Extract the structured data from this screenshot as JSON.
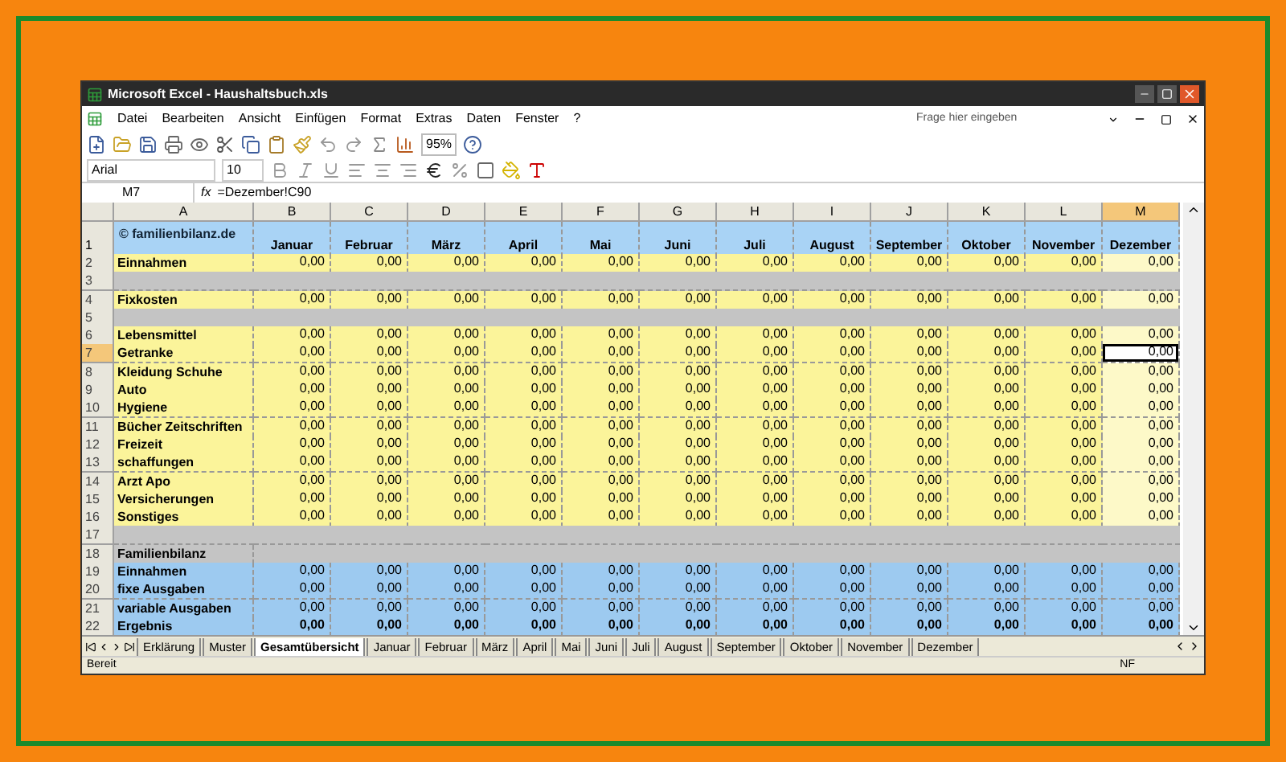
{
  "window": {
    "title": "Microsoft Excel - Haushaltsbuch.xls"
  },
  "menu": [
    "Datei",
    "Bearbeiten",
    "Ansicht",
    "Einfügen",
    "Format",
    "Extras",
    "Daten",
    "Fenster",
    "?"
  ],
  "help_field": {
    "placeholder": "Frage hier eingeben"
  },
  "toolbar": {
    "zoom": "95%",
    "font": "Arial",
    "font_size": "10"
  },
  "formula_bar": {
    "name_box": "M7",
    "fx": "fx",
    "formula": "=Dezember!C90"
  },
  "columns": [
    {
      "label": "A",
      "selected": false
    },
    {
      "label": "B",
      "selected": false
    },
    {
      "label": "C",
      "selected": false
    },
    {
      "label": "D",
      "selected": false
    },
    {
      "label": "E",
      "selected": false
    },
    {
      "label": "F",
      "selected": false
    },
    {
      "label": "G",
      "selected": false
    },
    {
      "label": "H",
      "selected": false
    },
    {
      "label": "I",
      "selected": false
    },
    {
      "label": "J",
      "selected": false
    },
    {
      "label": "K",
      "selected": false
    },
    {
      "label": "L",
      "selected": false
    },
    {
      "label": "M",
      "selected": true
    }
  ],
  "header_row": {
    "number": "1",
    "label": "© familienbilanz.de",
    "months": [
      "Januar",
      "Februar",
      "März",
      "April",
      "Mai",
      "Juni",
      "Juli",
      "August",
      "September",
      "Oktober",
      "November",
      "Dezember"
    ]
  },
  "rows": [
    {
      "number": "2",
      "kind": "data",
      "selected": false,
      "label": "Einnahmen",
      "values": [
        "0,00",
        "0,00",
        "0,00",
        "0,00",
        "0,00",
        "0,00",
        "0,00",
        "0,00",
        "0,00",
        "0,00",
        "0,00",
        "0,00"
      ]
    },
    {
      "number": "3",
      "kind": "gap",
      "selected": false
    },
    {
      "number": "4",
      "kind": "data",
      "selected": false,
      "label": "Fixkosten",
      "values": [
        "0,00",
        "0,00",
        "0,00",
        "0,00",
        "0,00",
        "0,00",
        "0,00",
        "0,00",
        "0,00",
        "0,00",
        "0,00",
        "0,00"
      ]
    },
    {
      "number": "5",
      "kind": "gap",
      "selected": false
    },
    {
      "number": "6",
      "kind": "data",
      "selected": false,
      "label": "Lebensmittel",
      "values": [
        "0,00",
        "0,00",
        "0,00",
        "0,00",
        "0,00",
        "0,00",
        "0,00",
        "0,00",
        "0,00",
        "0,00",
        "0,00",
        "0,00"
      ]
    },
    {
      "number": "7",
      "kind": "data",
      "selected": true,
      "label": "Getranke",
      "values": [
        "0,00",
        "0,00",
        "0,00",
        "0,00",
        "0,00",
        "0,00",
        "0,00",
        "0,00",
        "0,00",
        "0,00",
        "0,00",
        "0,00"
      ]
    },
    {
      "number": "8",
      "kind": "data",
      "selected": false,
      "label": "Kleidung  Schuhe",
      "values": [
        "0,00",
        "0,00",
        "0,00",
        "0,00",
        "0,00",
        "0,00",
        "0,00",
        "0,00",
        "0,00",
        "0,00",
        "0,00",
        "0,00"
      ]
    },
    {
      "number": "9",
      "kind": "data",
      "selected": false,
      "label": "Auto",
      "values": [
        "0,00",
        "0,00",
        "0,00",
        "0,00",
        "0,00",
        "0,00",
        "0,00",
        "0,00",
        "0,00",
        "0,00",
        "0,00",
        "0,00"
      ]
    },
    {
      "number": "10",
      "kind": "data",
      "selected": false,
      "label": "Hygiene",
      "values": [
        "0,00",
        "0,00",
        "0,00",
        "0,00",
        "0,00",
        "0,00",
        "0,00",
        "0,00",
        "0,00",
        "0,00",
        "0,00",
        "0,00"
      ]
    },
    {
      "number": "11",
      "kind": "data",
      "selected": false,
      "label": "Bücher Zeitschriften",
      "values": [
        "0,00",
        "0,00",
        "0,00",
        "0,00",
        "0,00",
        "0,00",
        "0,00",
        "0,00",
        "0,00",
        "0,00",
        "0,00",
        "0,00"
      ]
    },
    {
      "number": "12",
      "kind": "data",
      "selected": false,
      "label": "Freizeit",
      "values": [
        "0,00",
        "0,00",
        "0,00",
        "0,00",
        "0,00",
        "0,00",
        "0,00",
        "0,00",
        "0,00",
        "0,00",
        "0,00",
        "0,00"
      ]
    },
    {
      "number": "13",
      "kind": "data",
      "selected": false,
      "label": "schaffungen",
      "values": [
        "0,00",
        "0,00",
        "0,00",
        "0,00",
        "0,00",
        "0,00",
        "0,00",
        "0,00",
        "0,00",
        "0,00",
        "0,00",
        "0,00"
      ]
    },
    {
      "number": "14",
      "kind": "data",
      "selected": false,
      "label": "Arzt Apo",
      "values": [
        "0,00",
        "0,00",
        "0,00",
        "0,00",
        "0,00",
        "0,00",
        "0,00",
        "0,00",
        "0,00",
        "0,00",
        "0,00",
        "0,00"
      ]
    },
    {
      "number": "15",
      "kind": "data",
      "selected": false,
      "label": "Versicherungen",
      "values": [
        "0,00",
        "0,00",
        "0,00",
        "0,00",
        "0,00",
        "0,00",
        "0,00",
        "0,00",
        "0,00",
        "0,00",
        "0,00",
        "0,00"
      ]
    },
    {
      "number": "16",
      "kind": "data",
      "selected": false,
      "label": "Sonstiges",
      "values": [
        "0,00",
        "0,00",
        "0,00",
        "0,00",
        "0,00",
        "0,00",
        "0,00",
        "0,00",
        "0,00",
        "0,00",
        "0,00",
        "0,00"
      ]
    },
    {
      "number": "17",
      "kind": "gap",
      "selected": false
    },
    {
      "number": "18",
      "kind": "section",
      "selected": false,
      "label": "Familienbilanz"
    },
    {
      "number": "19",
      "kind": "summary",
      "selected": false,
      "label": "Einnahmen",
      "values": [
        "0,00",
        "0,00",
        "0,00",
        "0,00",
        "0,00",
        "0,00",
        "0,00",
        "0,00",
        "0,00",
        "0,00",
        "0,00",
        "0,00"
      ]
    },
    {
      "number": "20",
      "kind": "summary",
      "selected": false,
      "label": "fixe Ausgaben",
      "values": [
        "0,00",
        "0,00",
        "0,00",
        "0,00",
        "0,00",
        "0,00",
        "0,00",
        "0,00",
        "0,00",
        "0,00",
        "0,00",
        "0,00"
      ]
    },
    {
      "number": "21",
      "kind": "summary",
      "selected": false,
      "label": "variable Ausgaben",
      "values": [
        "0,00",
        "0,00",
        "0,00",
        "0,00",
        "0,00",
        "0,00",
        "0,00",
        "0,00",
        "0,00",
        "0,00",
        "0,00",
        "0,00"
      ]
    },
    {
      "number": "22",
      "kind": "total",
      "selected": false,
      "label": "Ergebnis",
      "values": [
        "0,00",
        "0,00",
        "0,00",
        "0,00",
        "0,00",
        "0,00",
        "0,00",
        "0,00",
        "0,00",
        "0,00",
        "0,00",
        "0,00"
      ]
    }
  ],
  "sheet_tabs": [
    {
      "label": "Erklärung",
      "selected": false
    },
    {
      "label": "Muster",
      "selected": false
    },
    {
      "label": "Gesamtübersicht",
      "selected": true
    },
    {
      "label": "Januar",
      "selected": false
    },
    {
      "label": "Februar",
      "selected": false
    },
    {
      "label": "März",
      "selected": false
    },
    {
      "label": "April",
      "selected": false
    },
    {
      "label": "Mai",
      "selected": false
    },
    {
      "label": "Juni",
      "selected": false
    },
    {
      "label": "Juli",
      "selected": false
    },
    {
      "label": "August",
      "selected": false
    },
    {
      "label": "September",
      "selected": false
    },
    {
      "label": "Oktober",
      "selected": false
    },
    {
      "label": "November",
      "selected": false
    },
    {
      "label": "Dezember",
      "selected": false
    }
  ],
  "status_bar": {
    "status": "Bereit",
    "mode": "NF"
  }
}
